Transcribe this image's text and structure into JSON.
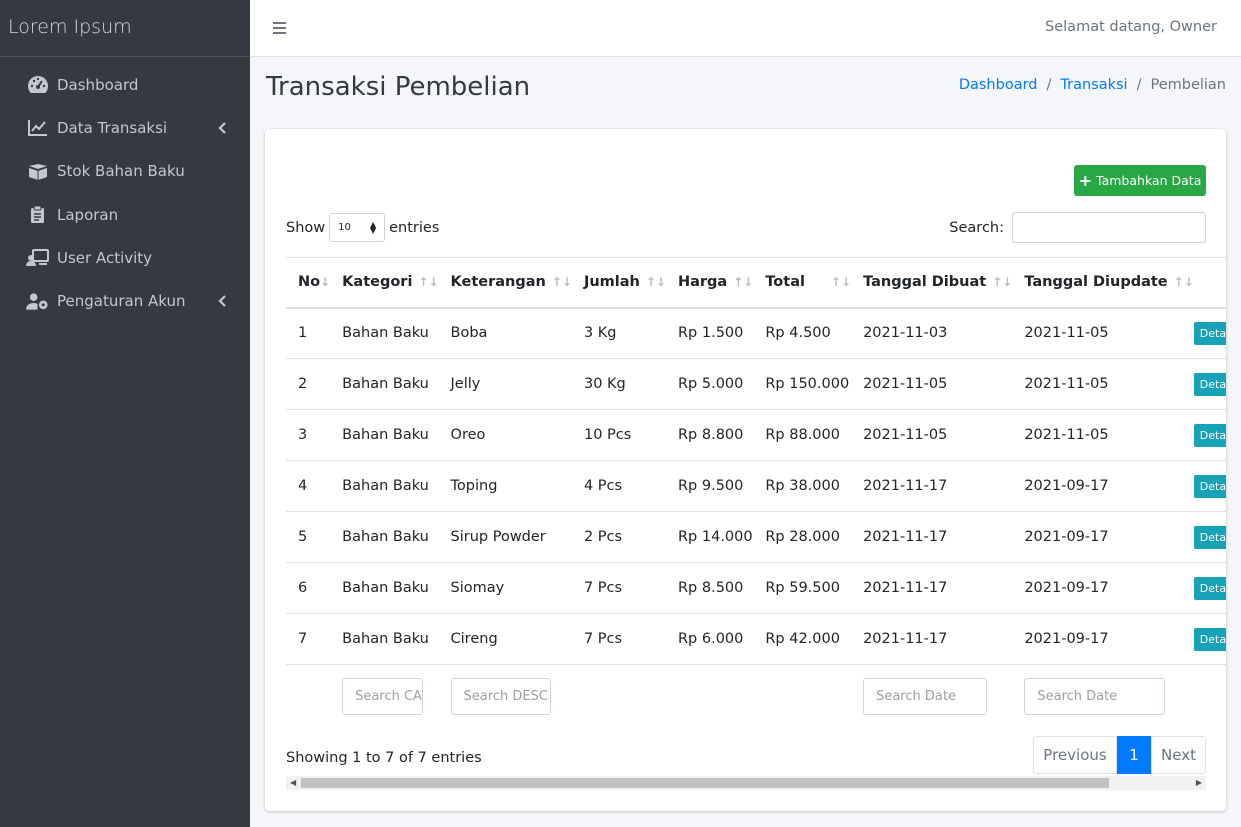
{
  "brand": "Lorem Ipsum",
  "sidebar": {
    "items": [
      {
        "label": "Dashboard",
        "icon": "tachometer-icon"
      },
      {
        "label": "Data Transaksi",
        "icon": "line-chart-icon",
        "has_submenu": true
      },
      {
        "label": "Stok Bahan Baku",
        "icon": "boxes-icon"
      },
      {
        "label": "Laporan",
        "icon": "clipboard-icon"
      },
      {
        "label": "User Activity",
        "icon": "user-monitor-icon"
      },
      {
        "label": "Pengaturan Akun",
        "icon": "user-cog-icon",
        "has_submenu": true
      }
    ]
  },
  "topnav": {
    "welcome": "Selamat datang, Owner"
  },
  "page": {
    "title": "Transaksi Pembelian",
    "breadcrumb": [
      "Dashboard",
      "Transaksi",
      "Pembelian"
    ]
  },
  "toolbar": {
    "add_label": "Tambahkan Data"
  },
  "table_controls": {
    "show_label": "Show",
    "entries_label": "entries",
    "page_length": "10",
    "search_label": "Search:"
  },
  "table": {
    "headers": [
      "No",
      "Kategori",
      "Keterangan",
      "Jumlah",
      "Harga",
      "Total",
      "Tanggal Dibuat",
      "Tanggal Diupdate"
    ],
    "rows": [
      [
        "1",
        "Bahan Baku",
        "Boba",
        "3 Kg",
        "Rp 1.500",
        "Rp 4.500",
        "2021-11-03",
        "2021-11-05"
      ],
      [
        "2",
        "Bahan Baku",
        "Jelly",
        "30 Kg",
        "Rp 5.000",
        "Rp 150.000",
        "2021-11-05",
        "2021-11-05"
      ],
      [
        "3",
        "Bahan Baku",
        "Oreo",
        "10 Pcs",
        "Rp 8.800",
        "Rp 88.000",
        "2021-11-05",
        "2021-11-05"
      ],
      [
        "4",
        "Bahan Baku",
        "Toping",
        "4 Pcs",
        "Rp 9.500",
        "Rp 38.000",
        "2021-11-17",
        "2021-09-17"
      ],
      [
        "5",
        "Bahan Baku",
        "Sirup Powder",
        "2 Pcs",
        "Rp 14.000",
        "Rp 28.000",
        "2021-11-17",
        "2021-09-17"
      ],
      [
        "6",
        "Bahan Baku",
        "Siomay",
        "7 Pcs",
        "Rp 8.500",
        "Rp 59.500",
        "2021-11-17",
        "2021-09-17"
      ],
      [
        "7",
        "Bahan Baku",
        "Cireng",
        "7 Pcs",
        "Rp 6.000",
        "Rp 42.000",
        "2021-11-17",
        "2021-09-17"
      ]
    ],
    "detail_label": "Detail",
    "footer_search": {
      "kategori": "Search CA",
      "keterangan": "Search DESC",
      "dibuat": "Search Date",
      "diupdate": "Search Date"
    }
  },
  "info": "Showing 1 to 7 of 7 entries",
  "pagination": {
    "previous": "Previous",
    "current": "1",
    "next": "Next"
  },
  "colors": {
    "sidebar_bg": "#343a40",
    "primary": "#007bff",
    "success": "#28a745",
    "info": "#17a2b8"
  }
}
